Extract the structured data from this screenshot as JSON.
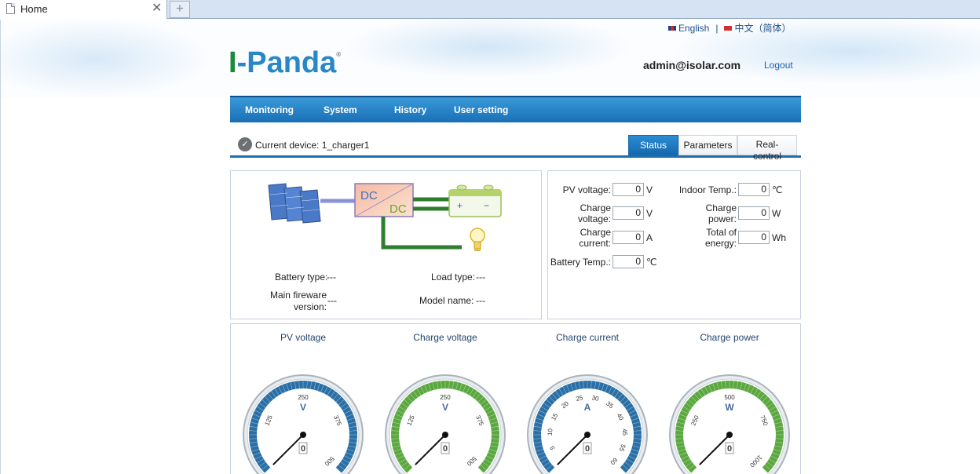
{
  "browser": {
    "tab_title": "Home",
    "close_glyph": "✕",
    "new_tab_glyph": "+"
  },
  "lang": {
    "english": "English",
    "separator": "|",
    "chinese": "中文（简体）"
  },
  "header": {
    "logo_prefix": "I",
    "logo_rest": "-Panda",
    "logo_mark": "®",
    "user": "admin@isolar.com",
    "logout": "Logout"
  },
  "nav": {
    "items": [
      "Monitoring",
      "System",
      "History",
      "User setting"
    ]
  },
  "device": {
    "check_glyph": "✓",
    "label": "Current device: 1_charger1"
  },
  "view_tabs": [
    "Status",
    "Parameters",
    "Real-control"
  ],
  "diagram": {
    "dc_top": "DC",
    "dc_bottom": "DC",
    "plus": "+",
    "minus": "−",
    "battery_type_label": "Battery type:",
    "battery_type_value": "---",
    "load_type_label": "Load type:",
    "load_type_value": "---",
    "firmware_label": "Main fireware version:",
    "firmware_value": "---",
    "model_label": "Model name:",
    "model_value": "---"
  },
  "readings": {
    "pv_voltage": {
      "label": "PV voltage:",
      "value": "0",
      "unit": "V"
    },
    "charge_voltage": {
      "label": "Charge voltage:",
      "value": "0",
      "unit": "V"
    },
    "charge_current": {
      "label": "Charge current:",
      "value": "0",
      "unit": "A"
    },
    "battery_temp": {
      "label": "Battery Temp.:",
      "value": "0",
      "unit": "℃"
    },
    "indoor_temp": {
      "label": "Indoor Temp.:",
      "value": "0",
      "unit": "℃"
    },
    "charge_power": {
      "label": "Charge power:",
      "value": "0",
      "unit": "W"
    },
    "total_energy": {
      "label": "Total of energy:",
      "value": "0",
      "unit": "Wh"
    }
  },
  "gauges": [
    {
      "title": "PV voltage",
      "unit": "V",
      "value": 0,
      "max": 500,
      "ticks": [
        "125",
        "250",
        "375",
        "500"
      ],
      "ring_color": "#2a6fa6"
    },
    {
      "title": "Charge voltage",
      "unit": "V",
      "value": 0,
      "max": 500,
      "ticks": [
        "125",
        "250",
        "375",
        "500"
      ],
      "ring_color": "#5aa83f"
    },
    {
      "title": "Charge current",
      "unit": "A",
      "value": 0,
      "max": 60,
      "ticks": [
        "5",
        "10",
        "15",
        "20",
        "25",
        "30",
        "35",
        "40",
        "45",
        "55",
        "60"
      ],
      "ring_color": "#2a6fa6"
    },
    {
      "title": "Charge power",
      "unit": "W",
      "value": 0,
      "max": 1000,
      "ticks": [
        "250",
        "500",
        "750",
        "1000"
      ],
      "ring_color": "#5aa83f"
    }
  ]
}
